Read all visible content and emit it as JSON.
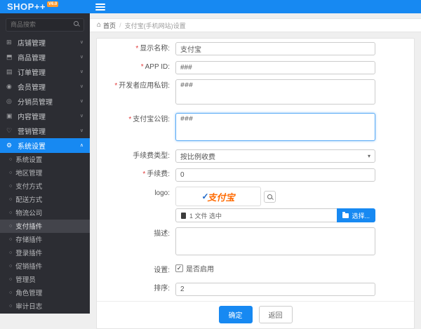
{
  "app": {
    "logo": "SHOP++",
    "version_badge": "V6.0"
  },
  "colors": {
    "primary": "#1789f2",
    "sidebar_bg": "#2c2d33",
    "badge": "#ff9a2e",
    "alipay_orange": "#ff6a00"
  },
  "sidebar": {
    "search_placeholder": "商品搜索",
    "menu": [
      {
        "label": "店铺管理",
        "icon": "store",
        "active": false
      },
      {
        "label": "商品管理",
        "icon": "goods",
        "active": false
      },
      {
        "label": "订单管理",
        "icon": "order",
        "active": false
      },
      {
        "label": "会员管理",
        "icon": "member",
        "active": false
      },
      {
        "label": "分销员管理",
        "icon": "distributor",
        "active": false
      },
      {
        "label": "内容管理",
        "icon": "content",
        "active": false
      },
      {
        "label": "营销管理",
        "icon": "marketing",
        "active": false
      },
      {
        "label": "系统设置",
        "icon": "settings",
        "active": true
      }
    ],
    "submenu": [
      {
        "label": "系统设置",
        "active": false
      },
      {
        "label": "地区管理",
        "active": false
      },
      {
        "label": "支付方式",
        "active": false
      },
      {
        "label": "配送方式",
        "active": false
      },
      {
        "label": "物流公司",
        "active": false
      },
      {
        "label": "支付插件",
        "active": true
      },
      {
        "label": "存储插件",
        "active": false
      },
      {
        "label": "登录插件",
        "active": false
      },
      {
        "label": "促销插件",
        "active": false
      },
      {
        "label": "管理员",
        "active": false
      },
      {
        "label": "角色管理",
        "active": false
      },
      {
        "label": "审计日志",
        "active": false
      }
    ]
  },
  "breadcrumb": {
    "home": "首页",
    "separator": "/",
    "current": "支付宝(手机网站)设置"
  },
  "form": {
    "display_name": {
      "label": "显示名称:",
      "value": "支付宝"
    },
    "app_id": {
      "label": "APP ID:",
      "value": "###"
    },
    "private_key": {
      "label": "开发者应用私钥:",
      "value": "###"
    },
    "public_key": {
      "label": "支付宝公钥:",
      "value": "###"
    },
    "fee_type": {
      "label": "手续费类型:",
      "value": "按比例收费"
    },
    "fee": {
      "label": "手续费:",
      "value": "0"
    },
    "logo": {
      "label": "logo:",
      "logo_text": "支付宝"
    },
    "upload": {
      "file_status": "1 文件 选中",
      "choose_label": "选择..."
    },
    "description": {
      "label": "描述:",
      "value": ""
    },
    "enable": {
      "label": "设置:",
      "checkbox_label": "是否启用",
      "checked": true
    },
    "sort": {
      "label": "排序:",
      "value": "2"
    },
    "actions": {
      "ok": "确定",
      "back": "返回"
    }
  }
}
